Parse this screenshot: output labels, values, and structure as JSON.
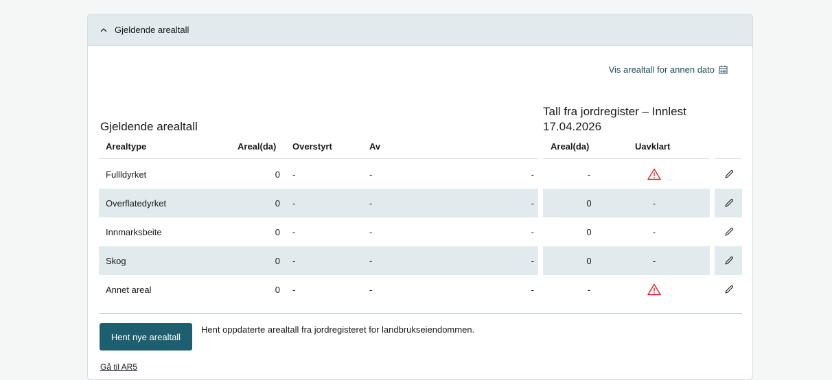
{
  "panel": {
    "header_title": "Gjeldende arealtall",
    "date_link": "Vis arealtall for annen dato",
    "section_title": "Gjeldende arealtall",
    "register_title": "Tall fra jordregister – Innlest 17.04.2026"
  },
  "table": {
    "headers": {
      "arealtype": "Arealtype",
      "areal": "Areal(da)",
      "overstyrt": "Overstyrt",
      "av": "Av",
      "reg_areal": "Areal(da)",
      "uavklart": "Uavklart"
    },
    "rows": [
      {
        "type": "Fullldyrket",
        "areal": "0",
        "overstyrt": "-",
        "av": "-",
        "extra": "-",
        "reg_areal": "-",
        "uavklart": "warning-icon"
      },
      {
        "type": "Overflatedyrket",
        "areal": "0",
        "overstyrt": "-",
        "av": "-",
        "extra": "-",
        "reg_areal": "0",
        "uavklart": "-"
      },
      {
        "type": "Innmarksbeite",
        "areal": "0",
        "overstyrt": "-",
        "av": "-",
        "extra": "-",
        "reg_areal": "0",
        "uavklart": "-"
      },
      {
        "type": "Skog",
        "areal": "0",
        "overstyrt": "-",
        "av": "-",
        "extra": "-",
        "reg_areal": "0",
        "uavklart": "-"
      },
      {
        "type": "Annet areal",
        "areal": "0",
        "overstyrt": "-",
        "av": "-",
        "extra": "-",
        "reg_areal": "-",
        "uavklart": "warning-icon"
      }
    ]
  },
  "footer": {
    "button_label": "Hent nye arealtall",
    "description": "Hent oppdaterte arealtall fra jordregisteret for landbrukseiendommen.",
    "link": "Gå til AR5"
  },
  "colors": {
    "header_bg": "#e1ebee",
    "stripe": "#e1ebee",
    "primary": "#1d5f6e",
    "link": "#1d4a5c",
    "warning": "#e02020"
  }
}
